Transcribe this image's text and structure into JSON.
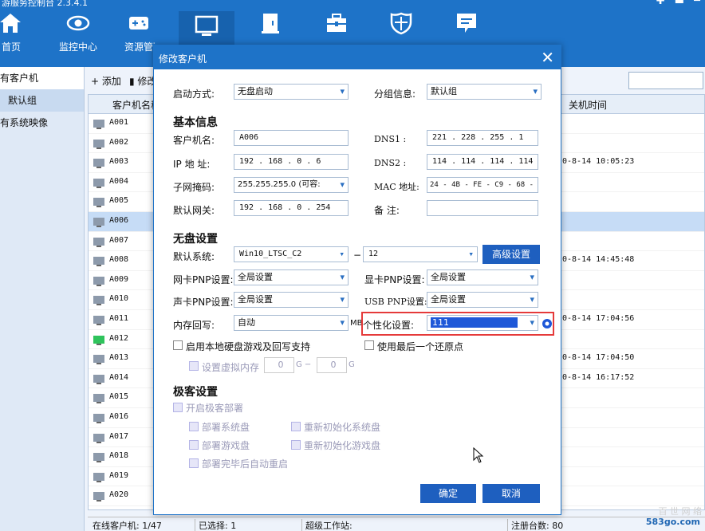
{
  "app": {
    "title": "游服务控制台 2.3.4.1",
    "window_controls": "✚ ▬ ─"
  },
  "nav": [
    {
      "label": "首页",
      "icon": "home-icon"
    },
    {
      "label": "监控中心",
      "icon": "eye-icon"
    },
    {
      "label": "资源管理",
      "icon": "gamepad-icon"
    },
    {
      "label": "",
      "icon": "computer-icon"
    },
    {
      "label": "",
      "icon": "document-icon"
    },
    {
      "label": "",
      "icon": "toolbox-icon"
    },
    {
      "label": "",
      "icon": "shield-icon"
    },
    {
      "label": "",
      "icon": "message-icon"
    }
  ],
  "sidebar": {
    "items": [
      {
        "label": "有客户机"
      },
      {
        "label": "默认组"
      },
      {
        "label": "有系统映像"
      }
    ]
  },
  "toolbar": {
    "add_label": "+ 添加",
    "edit_label": "▮ 修改"
  },
  "grid": {
    "headers": {
      "name": "客户机名称",
      "shutdown": "关机时间"
    },
    "rows": [
      {
        "name": "A001",
        "time": ""
      },
      {
        "name": "A002",
        "time": ""
      },
      {
        "name": "A003",
        "time": "0-8-14 10:05:23"
      },
      {
        "name": "A004",
        "time": ""
      },
      {
        "name": "A005",
        "time": ""
      },
      {
        "name": "A006",
        "time": ""
      },
      {
        "name": "A007",
        "time": ""
      },
      {
        "name": "A008",
        "time": "0-8-14 14:45:48"
      },
      {
        "name": "A009",
        "time": ""
      },
      {
        "name": "A010",
        "time": ""
      },
      {
        "name": "A011",
        "time": "0-8-14 17:04:56"
      },
      {
        "name": "A012",
        "time": ""
      },
      {
        "name": "A013",
        "time": "0-8-14 17:04:50"
      },
      {
        "name": "A014",
        "time": "0-8-14 16:17:52"
      },
      {
        "name": "A015",
        "time": ""
      },
      {
        "name": "A016",
        "time": ""
      },
      {
        "name": "A017",
        "time": ""
      },
      {
        "name": "A018",
        "time": ""
      },
      {
        "name": "A019",
        "time": ""
      },
      {
        "name": "A020",
        "time": ""
      }
    ]
  },
  "status": {
    "online": "在线客户机: 1/47",
    "selected": "已选择: 1",
    "super": "超级工作站:",
    "registered": "注册台数: 80"
  },
  "dialog": {
    "title": "修改客户机",
    "close": "✕",
    "boot_mode_label": "启动方式:",
    "boot_mode": "无盘启动",
    "group_label": "分组信息:",
    "group": "默认组",
    "basic_section": "基本信息",
    "name_label": "客户机名:",
    "name": "A006",
    "ip_label": "IP 地 址:",
    "ip": "192  .  168  .   0   .   6",
    "mask_label": "子网掩码:",
    "mask": "255.255.255.0  (可容:",
    "gateway_label": "默认网关:",
    "gateway": "192  .  168  .   0   .  254",
    "dns1_label": "DNS1    :",
    "dns1": "221  .  228  .  255  .   1",
    "dns2_label": "DNS2    :",
    "dns2": "114  .  114  .  114  .  114",
    "mac_label": "MAC 地址:",
    "mac": "24 - 4B - FE - C9 - 68 - BC",
    "note_label": "备    注:",
    "note": "",
    "diskless_section": "无盘设置",
    "default_sys_label": "默认系统:",
    "default_sys": "Win10_LTSC_C2",
    "dash": "−",
    "sys_num": "12",
    "advanced_button": "高级设置",
    "nic_pnp_label": "网卡PNP设置:",
    "nic_pnp": "全局设置",
    "gpu_pnp_label": "显卡PNP设置:",
    "gpu_pnp": "全局设置",
    "snd_pnp_label": "声卡PNP设置:",
    "snd_pnp": "全局设置",
    "usb_pnp_label": "USB PNP设置:",
    "usb_pnp": "全局设置",
    "mem_wb_label": "内存回写:",
    "mem_wb": "自动",
    "mb_unit": "MB",
    "personal_label": "个性化设置:",
    "personal": "111",
    "chk_local_disk": "启用本地硬盘游戏及回写支持",
    "chk_last_restore": "使用最后一个还原点",
    "chk_virtual_mem": "设置虚拟内存",
    "vm_from": "0",
    "vm_to": "0",
    "vm_unit1": "G −",
    "vm_unit2": "G",
    "speed_section": "极客设置",
    "chk_speed": "开启极客部署",
    "chk_deploy_sys": "部署系统盘",
    "chk_reinit_sys": "重新初始化系统盘",
    "chk_deploy_game": "部署游戏盘",
    "chk_reinit_game": "重新初始化游戏盘",
    "chk_auto_reboot": "部署完毕后自动重启",
    "ok_button": "确定",
    "cancel_button": "取消"
  },
  "watermark": {
    "text1": "百 世 网 络",
    "text2": "583go.com"
  }
}
